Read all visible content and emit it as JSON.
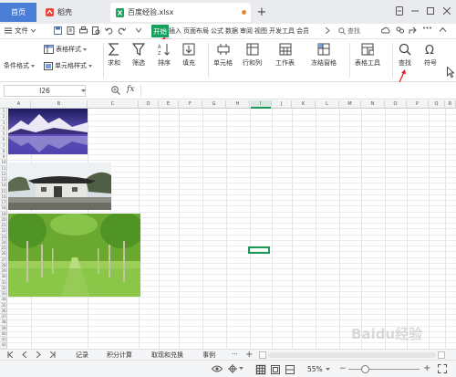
{
  "tabs": {
    "home": "首页",
    "daoke": "稻壳",
    "file": "百度经验.xlsx",
    "close_glyph": "×",
    "add_glyph": "+"
  },
  "menu": {
    "file": "文件",
    "start": "开始",
    "items": [
      "插入",
      "页面布局",
      "公式",
      "数据",
      "审阅",
      "视图",
      "开发工具",
      "会员"
    ],
    "search": "查找"
  },
  "ribbon": {
    "table_style": "表格样式",
    "cond_format": "条件格式",
    "cell_style": "单元格样式",
    "sum": "求和",
    "filter": "筛选",
    "sort": "排序",
    "fill": "填充",
    "cell": "单元格",
    "row_col": "行和列",
    "worksheet": "工作表",
    "freeze": "冻结窗格",
    "table_tools": "表格工具",
    "find": "查找",
    "symbol": "符号"
  },
  "formula": {
    "cell_ref": "I26",
    "fx": "fx"
  },
  "columns": [
    "A",
    "B",
    "C",
    "D",
    "E",
    "F",
    "G",
    "H",
    "I",
    "J",
    "K",
    "L",
    "M",
    "N",
    "O",
    "P",
    "Q",
    "R"
  ],
  "rows": [
    "1",
    "2",
    "3",
    "4",
    "5",
    "6",
    "7",
    "8",
    "9",
    "10",
    "11",
    "12",
    "13",
    "14",
    "15",
    "16",
    "17",
    "18",
    "19",
    "20",
    "21",
    "22",
    "23",
    "24",
    "25",
    "26",
    "27",
    "28",
    "29",
    "30",
    "31",
    "32",
    "33",
    "34",
    "35",
    "36",
    "37",
    "38",
    "39",
    "40",
    "41",
    "42",
    "43"
  ],
  "sheets": [
    "记录",
    "积分计算",
    "取现和兑换",
    "事例"
  ],
  "sheet_more": "···",
  "status": {
    "zoom": "55%"
  },
  "watermark": "Baidu经验",
  "colors": {
    "accent_green": "#16a05d",
    "home_tab_blue": "#4a7ed6",
    "selection_green": "#1b9a5a",
    "annotation_red": "#e02020"
  }
}
